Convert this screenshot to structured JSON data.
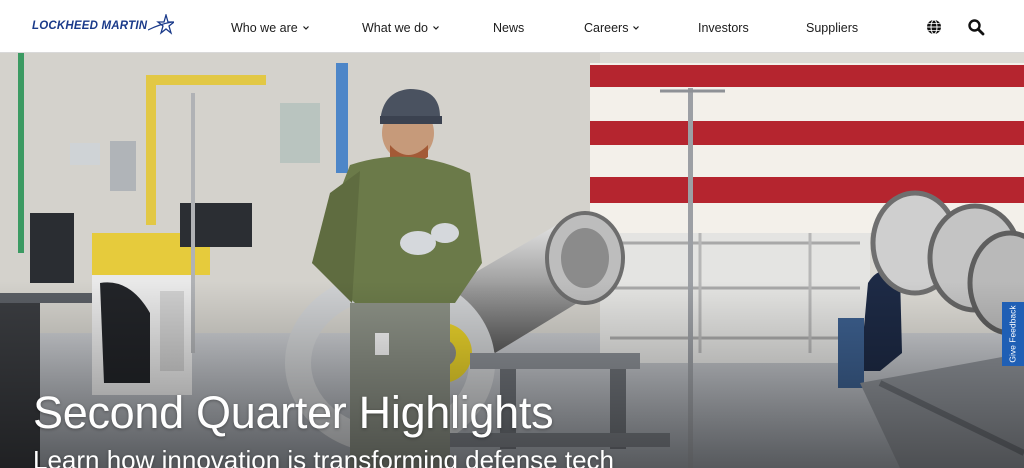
{
  "logo": {
    "text": "LOCKHEED MARTIN"
  },
  "nav": {
    "items": [
      {
        "label": "Who we are",
        "has_dropdown": true
      },
      {
        "label": "What we do",
        "has_dropdown": true
      },
      {
        "label": "News",
        "has_dropdown": false
      },
      {
        "label": "Careers",
        "has_dropdown": true
      },
      {
        "label": "Investors",
        "has_dropdown": false
      },
      {
        "label": "Suppliers",
        "has_dropdown": false
      }
    ],
    "icons": [
      "globe-icon",
      "search-icon"
    ]
  },
  "hero": {
    "title": "Second Quarter Highlights",
    "subtitle": "Learn how innovation is transforming defense tech"
  },
  "feedback": {
    "label": "Give Feedback"
  },
  "colors": {
    "brand": "#1a3a8a",
    "feedback": "#1f5fb5",
    "flag_red": "#b5252f"
  }
}
